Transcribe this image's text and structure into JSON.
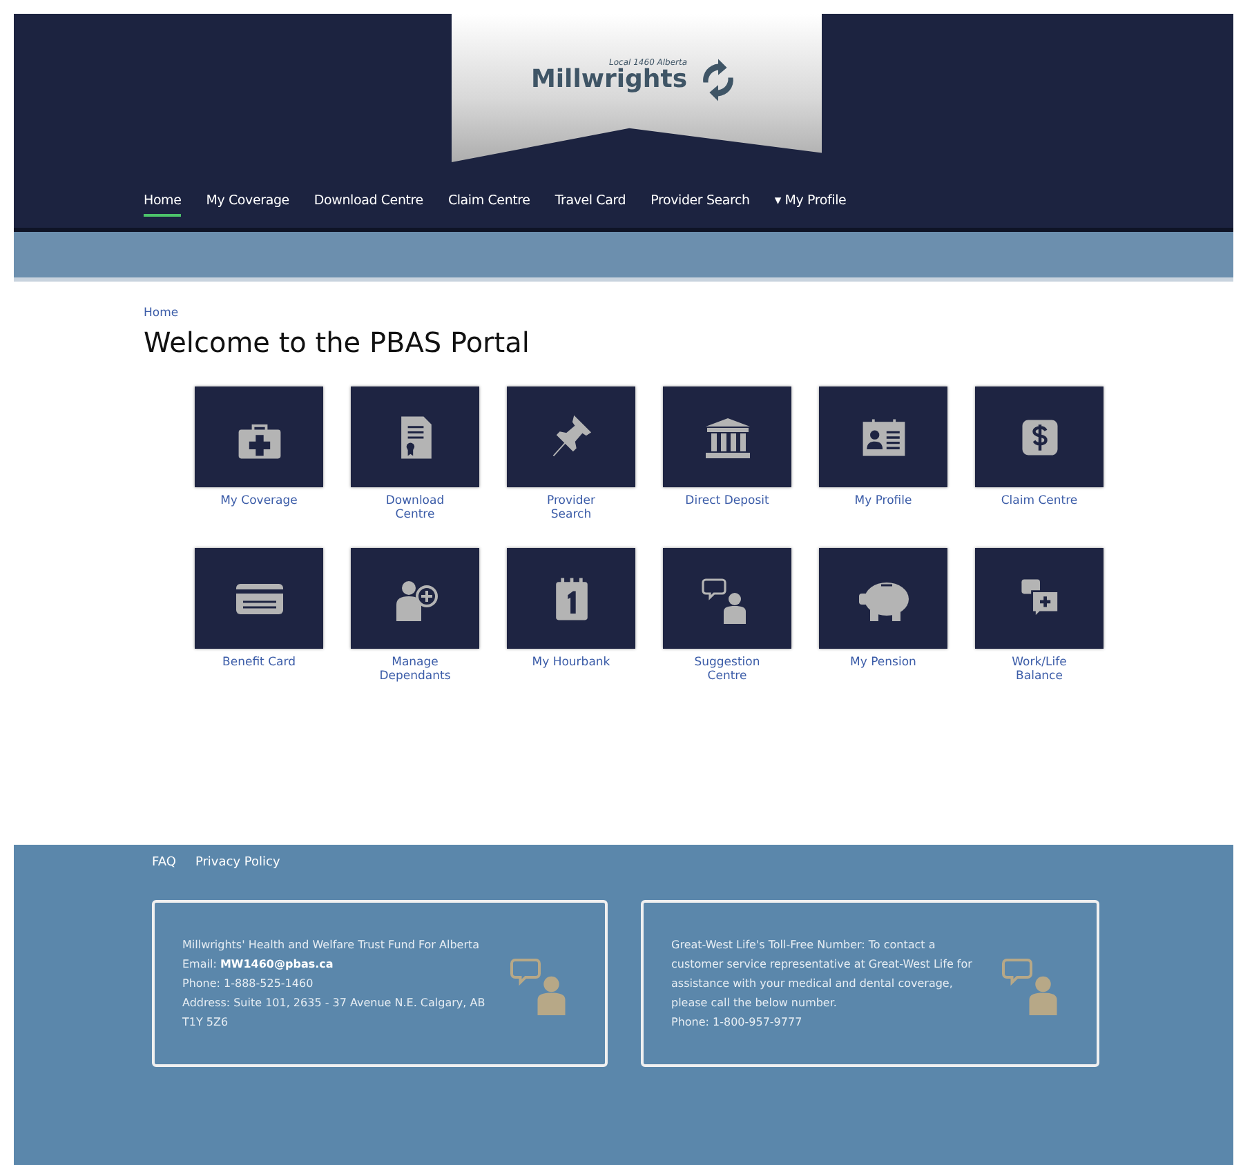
{
  "logo": {
    "subtitle": "Local 1460 Alberta",
    "name": "Millwrights"
  },
  "nav": [
    {
      "label": "Home",
      "selected": true
    },
    {
      "label": "My Coverage",
      "selected": false
    },
    {
      "label": "Download Centre",
      "selected": false
    },
    {
      "label": "Claim Centre",
      "selected": false
    },
    {
      "label": "Travel Card",
      "selected": false
    },
    {
      "label": "Provider Search",
      "selected": false
    },
    {
      "label": "▾ My Profile",
      "selected": false
    }
  ],
  "breadcrumb": "Home",
  "title": "Welcome to the PBAS Portal",
  "tiles": [
    {
      "label": "My Coverage"
    },
    {
      "label": "Download Centre"
    },
    {
      "label": "Provider Search"
    },
    {
      "label": "Direct Deposit"
    },
    {
      "label": "My Profile"
    },
    {
      "label": "Claim Centre"
    },
    {
      "label": "Benefit Card"
    },
    {
      "label": "Manage Dependants"
    },
    {
      "label": "My Hourbank"
    },
    {
      "label": "Suggestion Centre"
    },
    {
      "label": "My Pension"
    },
    {
      "label": "Work/Life Balance"
    }
  ],
  "footer": {
    "links": [
      "FAQ",
      "Privacy Policy"
    ],
    "boxes": [
      {
        "lines": [
          "Millwrights' Health and Welfare Trust Fund For Alberta",
          "Email: **MW1460@pbas.ca**",
          "Phone: 1-888-525-1460",
          "Address: Suite 101, 2635 - 37 Avenue N.E. Calgary, AB T1Y 5Z6"
        ]
      },
      {
        "lines": [
          "Great-West Life's Toll-Free Number: To contact a customer service representative at Great-West Life for assistance with your medical and dental coverage, please call the below number.",
          "Phone: 1-800-957-9777"
        ]
      }
    ]
  }
}
